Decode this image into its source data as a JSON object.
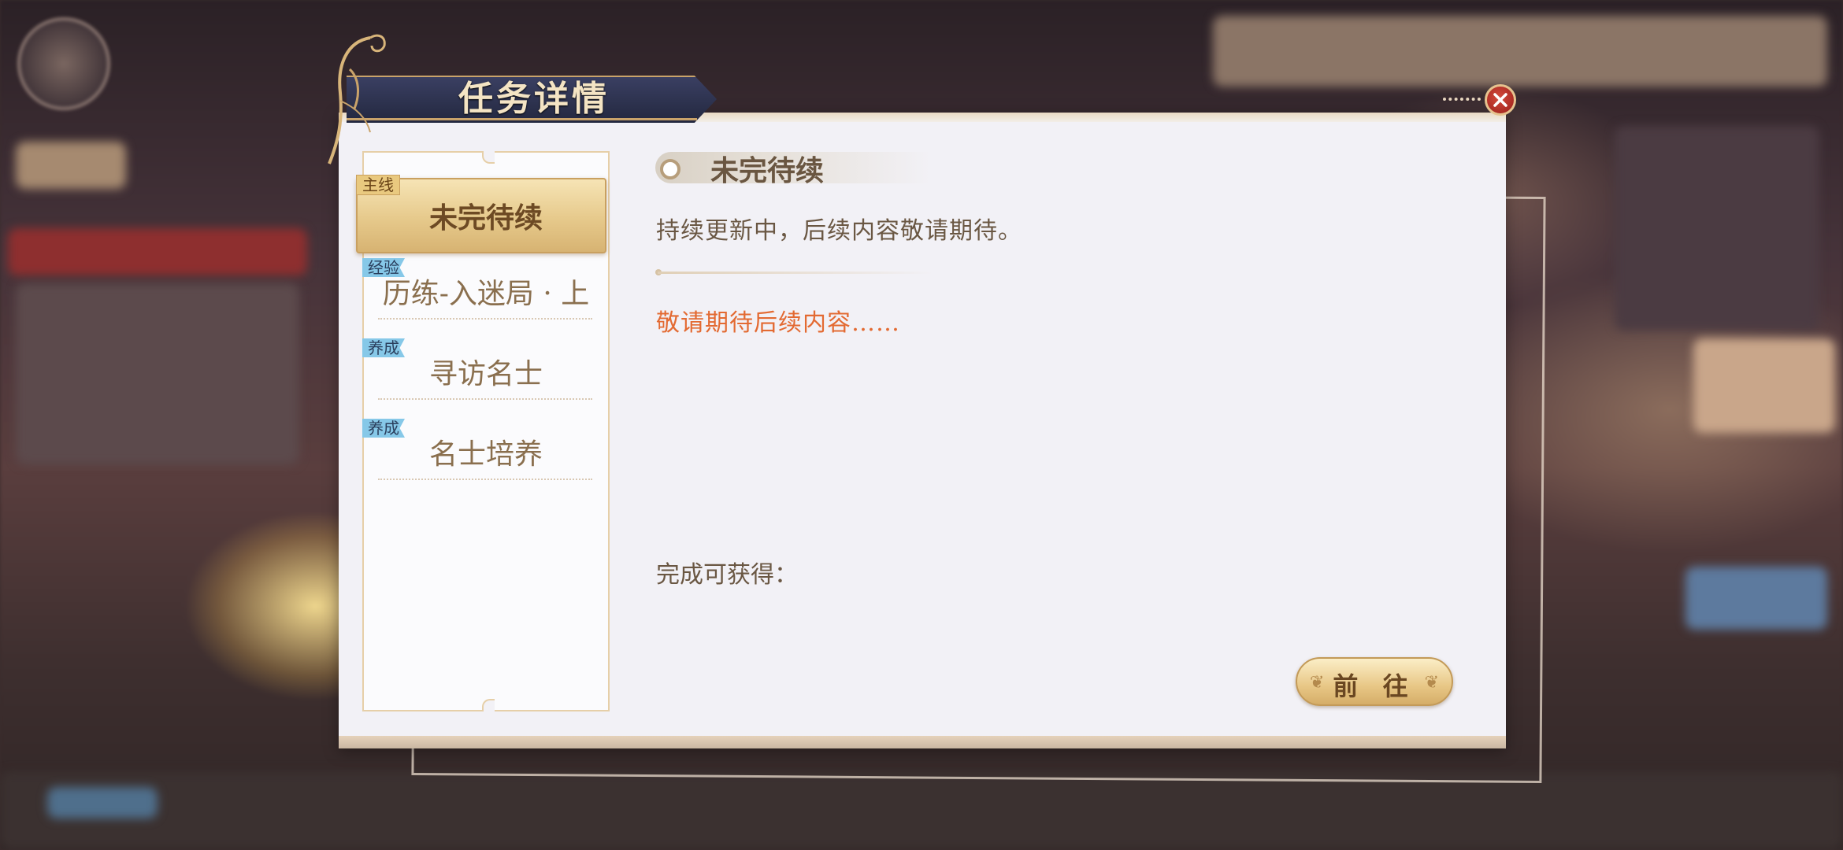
{
  "dialog": {
    "title": "任务详情",
    "close_icon": "close-icon"
  },
  "quests": [
    {
      "tag": "主线",
      "label": "未完待续",
      "selected": true
    },
    {
      "tag": "经验",
      "label": "历练-入迷局 · 上",
      "selected": false
    },
    {
      "tag": "养成",
      "label": "寻访名士",
      "selected": false
    },
    {
      "tag": "养成",
      "label": "名士培养",
      "selected": false
    }
  ],
  "detail": {
    "status": "未完待续",
    "description": "持续更新中，后续内容敬请期待。",
    "hint": "敬请期待后续内容……",
    "rewards_label": "完成可获得："
  },
  "actions": {
    "go_label": "前 往"
  },
  "colors": {
    "accent_gold": "#e6c98b",
    "hint_orange": "#e36a32",
    "ribbon_navy": "#23283f",
    "tag_blue": "#86c8e8",
    "close_red": "#c43a2e"
  }
}
